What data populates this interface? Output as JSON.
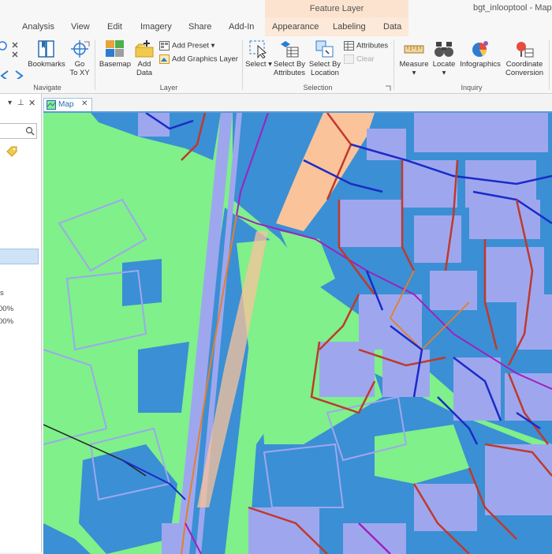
{
  "title_bar": {
    "contextual_header": "Feature Layer",
    "document_title": "bgt_inlooptool - Map"
  },
  "ribbon_tabs": [
    "t",
    "Analysis",
    "View",
    "Edit",
    "Imagery",
    "Share",
    "Add-In",
    "Appearance",
    "Labeling",
    "Data"
  ],
  "ribbon": {
    "navigate": {
      "label": "Navigate",
      "bookmarks": "Bookmarks",
      "go_to_xy_line1": "Go",
      "go_to_xy_line2": "To XY"
    },
    "layer": {
      "label": "Layer",
      "basemap": "Basemap",
      "add_data_line1": "Add",
      "add_data_line2": "Data",
      "add_preset": "Add Preset",
      "add_graphics_layer": "Add Graphics Layer"
    },
    "selection": {
      "label": "Selection",
      "select": "Select",
      "select_by_attributes_line1": "Select By",
      "select_by_attributes_line2": "Attributes",
      "select_by_location_line1": "Select By",
      "select_by_location_line2": "Location",
      "attributes": "Attributes",
      "clear": "Clear"
    },
    "inquiry": {
      "label": "Inquiry",
      "measure": "Measure",
      "locate": "Locate",
      "infographics": "Infographics",
      "coordinate_line1": "Coordinate",
      "coordinate_line2": "Conversion"
    }
  },
  "left_panel": {
    "labels": [
      "s",
      "00%",
      "00%"
    ]
  },
  "map": {
    "tab_label": "Map",
    "colors": {
      "land": "#7ff08a",
      "water": "#3b8fd4",
      "building": "#9ea7ee",
      "highlight": "#fbc39a",
      "road_red": "#c0392b",
      "road_blue": "#1a2bc8",
      "road_purple": "#a020c0",
      "road_orange": "#e87e26"
    }
  }
}
